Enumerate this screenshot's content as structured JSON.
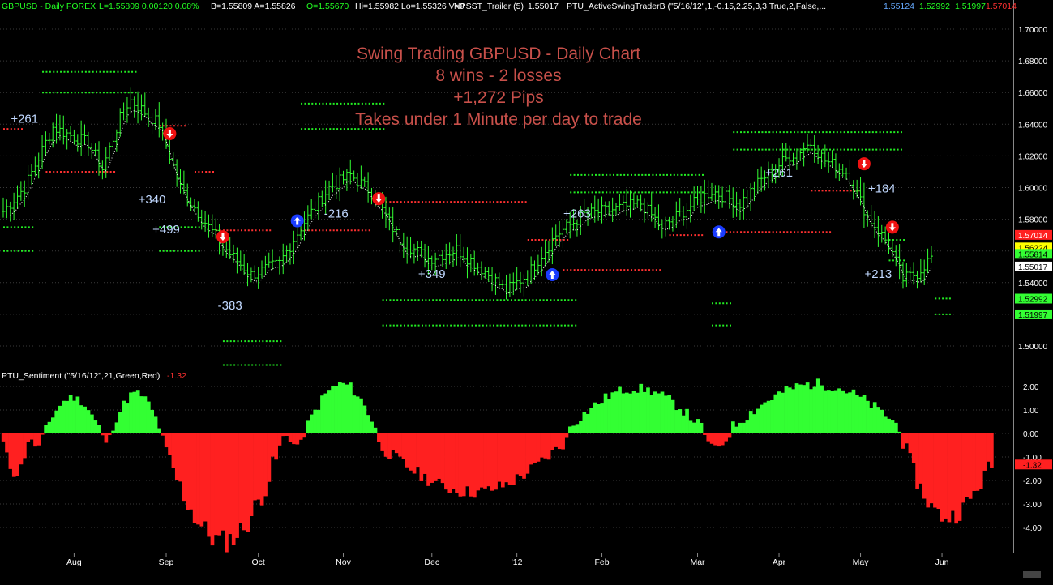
{
  "header": {
    "symbol": "GBPUSD - Daily FOREX",
    "stats": "L=1.55809  0.00120  0.08%",
    "quote": "B=1.55809  A=1.55826",
    "open": "O=1.55670",
    "hilo": "Hi=1.55982  Lo=1.55326  V=0",
    "trailer_name": "NPSST_Trailer (5)",
    "trailer_value": "1.55017",
    "swing_name": "PTU_ActiveSwingTraderB (\"5/16/12\",1,-0.15,2.25,3,3,True,2,False,...",
    "swing_v1": "1.55124",
    "swing_v2": "1.52992",
    "swing_v3": "1.51997",
    "swing_v4": "1.57014"
  },
  "overlay": {
    "line1": "Swing Trading GBPUSD - Daily Chart",
    "line2": "8 wins - 2 losses",
    "line3": "+1,272 Pips",
    "line4": "Takes under 1 Minute per day to trade"
  },
  "sentiment": {
    "label": "PTU_Sentiment (\"5/16/12\",21,Green,Red)",
    "value": "-1.32"
  },
  "colors": {
    "bull": "#33ff33",
    "bear": "#ff2020",
    "stop_red": "#ff3030",
    "stop_green": "#22ee22",
    "trade_label": "#c0d8ff",
    "overlay_text": "#c8504a",
    "axis_text": "#ffffff",
    "grid": "#3a3a3a",
    "up_arrow": "#1a3cff",
    "down_arrow": "#ee1111"
  },
  "chart_data": [
    {
      "type": "candlestick",
      "y_ticks": [
        "1.70000",
        "1.68000",
        "1.66000",
        "1.64000",
        "1.62000",
        "1.60000",
        "1.58000",
        "1.56000",
        "1.54000",
        "1.52000",
        "1.50000"
      ],
      "ylim": [
        1.48,
        1.71
      ],
      "x_ticks": [
        "Aug",
        "Sep",
        "Oct",
        "Nov",
        "Dec",
        "'12",
        "Feb",
        "Mar",
        "Apr",
        "May",
        "Jun"
      ],
      "price_tags": [
        {
          "label": "1.57014",
          "value": 1.57014,
          "bg": "#ff2020",
          "fg": "#ffffff"
        },
        {
          "label": "1.56224",
          "value": 1.56224,
          "bg": "#ffff00",
          "fg": "#000000"
        },
        {
          "label": "1.55814",
          "value": 1.55814,
          "bg": "#33ff33",
          "fg": "#000000"
        },
        {
          "label": "1.55017",
          "value": 1.55017,
          "bg": "#ffffff",
          "fg": "#000000"
        },
        {
          "label": "1.52992",
          "value": 1.52992,
          "bg": "#33ff33",
          "fg": "#000000"
        },
        {
          "label": "1.51997",
          "value": 1.51997,
          "bg": "#33ff33",
          "fg": "#000000"
        }
      ],
      "anchors": [
        {
          "i": 0,
          "p": 1.585
        },
        {
          "i": 6,
          "p": 1.6
        },
        {
          "i": 14,
          "p": 1.638
        },
        {
          "i": 24,
          "p": 1.628
        },
        {
          "i": 28,
          "p": 1.612
        },
        {
          "i": 34,
          "p": 1.65
        },
        {
          "i": 36,
          "p": 1.655
        },
        {
          "i": 44,
          "p": 1.64
        },
        {
          "i": 50,
          "p": 1.6
        },
        {
          "i": 58,
          "p": 1.575
        },
        {
          "i": 64,
          "p": 1.558
        },
        {
          "i": 70,
          "p": 1.545
        },
        {
          "i": 78,
          "p": 1.552
        },
        {
          "i": 84,
          "p": 1.575
        },
        {
          "i": 92,
          "p": 1.6
        },
        {
          "i": 98,
          "p": 1.608
        },
        {
          "i": 104,
          "p": 1.597
        },
        {
          "i": 112,
          "p": 1.567
        },
        {
          "i": 120,
          "p": 1.555
        },
        {
          "i": 128,
          "p": 1.561
        },
        {
          "i": 136,
          "p": 1.547
        },
        {
          "i": 142,
          "p": 1.535
        },
        {
          "i": 148,
          "p": 1.545
        },
        {
          "i": 156,
          "p": 1.57
        },
        {
          "i": 164,
          "p": 1.583
        },
        {
          "i": 172,
          "p": 1.586
        },
        {
          "i": 180,
          "p": 1.59
        },
        {
          "i": 186,
          "p": 1.575
        },
        {
          "i": 192,
          "p": 1.585
        },
        {
          "i": 200,
          "p": 1.598
        },
        {
          "i": 208,
          "p": 1.59
        },
        {
          "i": 214,
          "p": 1.605
        },
        {
          "i": 222,
          "p": 1.62
        },
        {
          "i": 228,
          "p": 1.628
        },
        {
          "i": 232,
          "p": 1.617
        },
        {
          "i": 238,
          "p": 1.61
        },
        {
          "i": 244,
          "p": 1.582
        },
        {
          "i": 250,
          "p": 1.564
        },
        {
          "i": 254,
          "p": 1.542
        },
        {
          "i": 258,
          "p": 1.546
        },
        {
          "i": 262,
          "p": 1.556
        }
      ],
      "bar_count": 263,
      "trade_labels": [
        {
          "text": "+261",
          "i": 6,
          "p": 1.641
        },
        {
          "text": "+340",
          "i": 42,
          "p": 1.59
        },
        {
          "text": "+499",
          "i": 46,
          "p": 1.571
        },
        {
          "text": "-383",
          "i": 64,
          "p": 1.523
        },
        {
          "text": "-216",
          "i": 94,
          "p": 1.581
        },
        {
          "text": "+349",
          "i": 121,
          "p": 1.543
        },
        {
          "text": "+263",
          "i": 162,
          "p": 1.581
        },
        {
          "text": "+261",
          "i": 219,
          "p": 1.607
        },
        {
          "text": "+184",
          "i": 248,
          "p": 1.597
        },
        {
          "text": "+213",
          "i": 247,
          "p": 1.543
        }
      ],
      "arrows": [
        {
          "dir": "down",
          "i": 47,
          "p": 1.634
        },
        {
          "dir": "down",
          "i": 62,
          "p": 1.569
        },
        {
          "dir": "up",
          "i": 83,
          "p": 1.579
        },
        {
          "dir": "down",
          "i": 106,
          "p": 1.593
        },
        {
          "dir": "up",
          "i": 155,
          "p": 1.545
        },
        {
          "dir": "up",
          "i": 202,
          "p": 1.572
        },
        {
          "dir": "down",
          "i": 243,
          "p": 1.615
        },
        {
          "dir": "down",
          "i": 251,
          "p": 1.575
        }
      ],
      "stop_levels": [
        {
          "color": "red",
          "p": 1.637,
          "i0": 0,
          "i1": 6
        },
        {
          "color": "red",
          "p": 1.61,
          "i0": 12,
          "i1": 32
        },
        {
          "color": "red",
          "p": 1.639,
          "i0": 44,
          "i1": 52
        },
        {
          "color": "red",
          "p": 1.61,
          "i0": 54,
          "i1": 60
        },
        {
          "color": "red",
          "p": 1.573,
          "i0": 60,
          "i1": 76
        },
        {
          "color": "red",
          "p": 1.573,
          "i0": 84,
          "i1": 104
        },
        {
          "color": "red",
          "p": 1.591,
          "i0": 106,
          "i1": 148
        },
        {
          "color": "red",
          "p": 1.567,
          "i0": 148,
          "i1": 160
        },
        {
          "color": "red",
          "p": 1.548,
          "i0": 158,
          "i1": 186
        },
        {
          "color": "red",
          "p": 1.57,
          "i0": 188,
          "i1": 198
        },
        {
          "color": "red",
          "p": 1.572,
          "i0": 204,
          "i1": 234
        },
        {
          "color": "red",
          "p": 1.598,
          "i0": 228,
          "i1": 242
        },
        {
          "color": "green",
          "p": 1.673,
          "i0": 11,
          "i1": 38
        },
        {
          "color": "green",
          "p": 1.66,
          "i0": 11,
          "i1": 38
        },
        {
          "color": "green",
          "p": 1.575,
          "i0": 0,
          "i1": 9
        },
        {
          "color": "green",
          "p": 1.56,
          "i0": 0,
          "i1": 9
        },
        {
          "color": "green",
          "p": 1.575,
          "i0": 44,
          "i1": 56
        },
        {
          "color": "green",
          "p": 1.56,
          "i0": 44,
          "i1": 56
        },
        {
          "color": "green",
          "p": 1.653,
          "i0": 84,
          "i1": 108
        },
        {
          "color": "green",
          "p": 1.637,
          "i0": 84,
          "i1": 108
        },
        {
          "color": "green",
          "p": 1.503,
          "i0": 62,
          "i1": 79
        },
        {
          "color": "green",
          "p": 1.488,
          "i0": 62,
          "i1": 79
        },
        {
          "color": "green",
          "p": 1.529,
          "i0": 107,
          "i1": 162
        },
        {
          "color": "green",
          "p": 1.513,
          "i0": 107,
          "i1": 162
        },
        {
          "color": "green",
          "p": 1.608,
          "i0": 160,
          "i1": 198
        },
        {
          "color": "green",
          "p": 1.597,
          "i0": 160,
          "i1": 198
        },
        {
          "color": "green",
          "p": 1.635,
          "i0": 206,
          "i1": 254
        },
        {
          "color": "green",
          "p": 1.624,
          "i0": 206,
          "i1": 254
        },
        {
          "color": "green",
          "p": 1.527,
          "i0": 200,
          "i1": 206
        },
        {
          "color": "green",
          "p": 1.513,
          "i0": 200,
          "i1": 206
        },
        {
          "color": "green",
          "p": 1.567,
          "i0": 250,
          "i1": 255
        },
        {
          "color": "green",
          "p": 1.554,
          "i0": 250,
          "i1": 255
        },
        {
          "color": "green",
          "p": 1.53,
          "i0": 263,
          "i1": 268
        },
        {
          "color": "green",
          "p": 1.52,
          "i0": 263,
          "i1": 268
        }
      ]
    },
    {
      "type": "bar",
      "title": "PTU_Sentiment",
      "y_ticks": [
        "2.00",
        "1.00",
        "0.00",
        "-1.00",
        "-2.00",
        "-3.00",
        "-4.00"
      ],
      "ylim": [
        -4.9,
        2.3
      ],
      "current_value": -1.32,
      "segments": [
        {
          "i0": 0,
          "i1": 8,
          "start": -0.4,
          "peak": -1.8,
          "end": -0.3
        },
        {
          "i0": 8,
          "i1": 12,
          "start": -0.3,
          "peak": -0.6,
          "end": -0.1
        },
        {
          "i0": 12,
          "i1": 28,
          "start": 0.2,
          "peak": 1.6,
          "end": 0.3
        },
        {
          "i0": 28,
          "i1": 31,
          "start": -0.1,
          "peak": -0.4,
          "end": -0.1
        },
        {
          "i0": 31,
          "i1": 45,
          "start": 0.3,
          "peak": 1.8,
          "end": 0.3
        },
        {
          "i0": 45,
          "i1": 80,
          "start": -0.5,
          "peak": -4.8,
          "end": -0.3
        },
        {
          "i0": 80,
          "i1": 86,
          "start": -0.1,
          "peak": -0.5,
          "end": -0.1
        },
        {
          "i0": 86,
          "i1": 106,
          "start": 0.4,
          "peak": 2.2,
          "end": 0.3
        },
        {
          "i0": 106,
          "i1": 160,
          "start": -0.5,
          "peak": -2.6,
          "end": -0.3
        },
        {
          "i0": 160,
          "i1": 198,
          "start": 0.3,
          "peak": 2.0,
          "end": 0.3
        },
        {
          "i0": 198,
          "i1": 206,
          "start": -0.1,
          "peak": -0.6,
          "end": -0.1
        },
        {
          "i0": 206,
          "i1": 254,
          "start": 0.3,
          "peak": 2.2,
          "end": 0.3
        },
        {
          "i0": 254,
          "i1": 280,
          "start": -0.4,
          "peak": -3.7,
          "end": -1.3
        }
      ]
    }
  ]
}
